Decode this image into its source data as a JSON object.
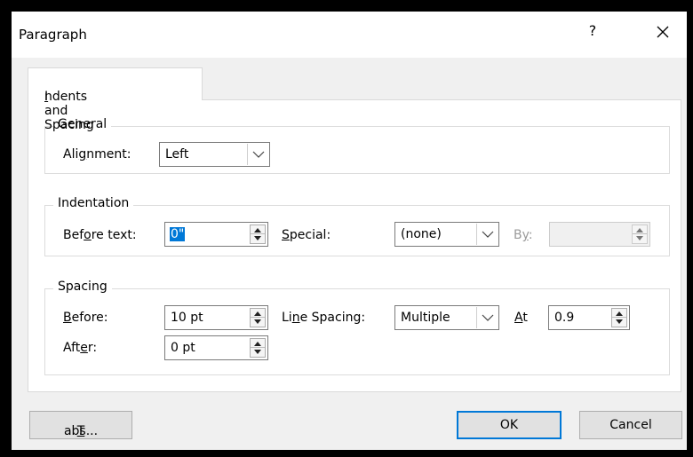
{
  "dialog": {
    "title": "Paragraph",
    "help_label": "?",
    "close_icon": "close-icon"
  },
  "tab": {
    "label_u": "I",
    "label_rest": "ndents and Spacing"
  },
  "general": {
    "title": "General",
    "alignment_label": {
      "pre": "Ali",
      "u": "g",
      "post": "nment:"
    },
    "alignment_value": "Left"
  },
  "indentation": {
    "title": "Indentation",
    "before_text_label": {
      "pre": "Bef",
      "u": "o",
      "post": "re text:"
    },
    "before_text_value": "0\"",
    "special_label": {
      "u": "S",
      "post": "pecial:"
    },
    "special_value": "(none)",
    "by_label": {
      "pre": "B",
      "u": "y",
      "post": ":"
    },
    "by_value": ""
  },
  "spacing": {
    "title": "Spacing",
    "before_label": {
      "u": "B",
      "post": "efore:"
    },
    "before_value": "10 pt",
    "after_label": {
      "pre": "Aft",
      "u": "e",
      "post": "r:"
    },
    "after_value": "0 pt",
    "line_spacing_label": {
      "pre": "Li",
      "u": "n",
      "post": "e Spacing:"
    },
    "line_spacing_value": "Multiple",
    "at_label": {
      "u": "A",
      "post": "t"
    },
    "at_value": "0.9"
  },
  "buttons": {
    "tabs": {
      "u": "T",
      "post": "abs..."
    },
    "ok": "OK",
    "cancel": "Cancel"
  },
  "colors": {
    "accent": "#0078d7",
    "background": "#f0f0f0",
    "frame": "#000000"
  }
}
